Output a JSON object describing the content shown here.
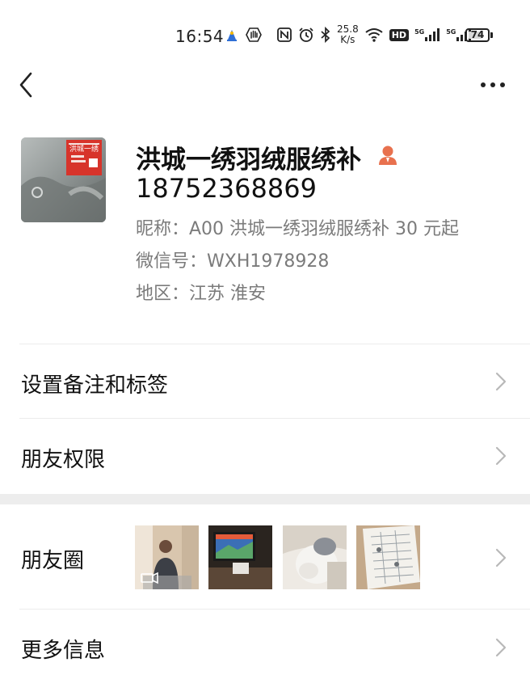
{
  "status_bar": {
    "time": "16:54",
    "speed_value": "25.8",
    "speed_unit": "K/s",
    "signal_1_label": "5G",
    "signal_2_label": "5G",
    "hd_label": "HD",
    "battery_level": "74",
    "icons": [
      "app-notification-icon",
      "hand-icon",
      "nfc-icon",
      "alarm-icon",
      "bluetooth-icon",
      "wifi-icon",
      "hd-icon",
      "signal-icon",
      "signal-icon",
      "battery-icon"
    ]
  },
  "nav": {
    "back_icon": "chevron-left-icon",
    "more_icon": "more-dots-icon"
  },
  "profile": {
    "name": "洪城一绣羽绒服绣补",
    "phone": "18752368869",
    "nickname": "昵称：A00 洪城一绣羽绒服绣补 30 元起",
    "wechat_id": "微信号：WXH1978928",
    "region": "地区：江苏  淮安",
    "avatar_sign_text": "洪城一绣",
    "badge_color": "#e8714e"
  },
  "rows": {
    "remark": "设置备注和标签",
    "permissions": "朋友权限",
    "moments": "朋友圈",
    "more_info": "更多信息"
  },
  "colors": {
    "secondary_text": "#7b7b7b",
    "divider": "#ececec",
    "section_gap": "#ededed"
  }
}
